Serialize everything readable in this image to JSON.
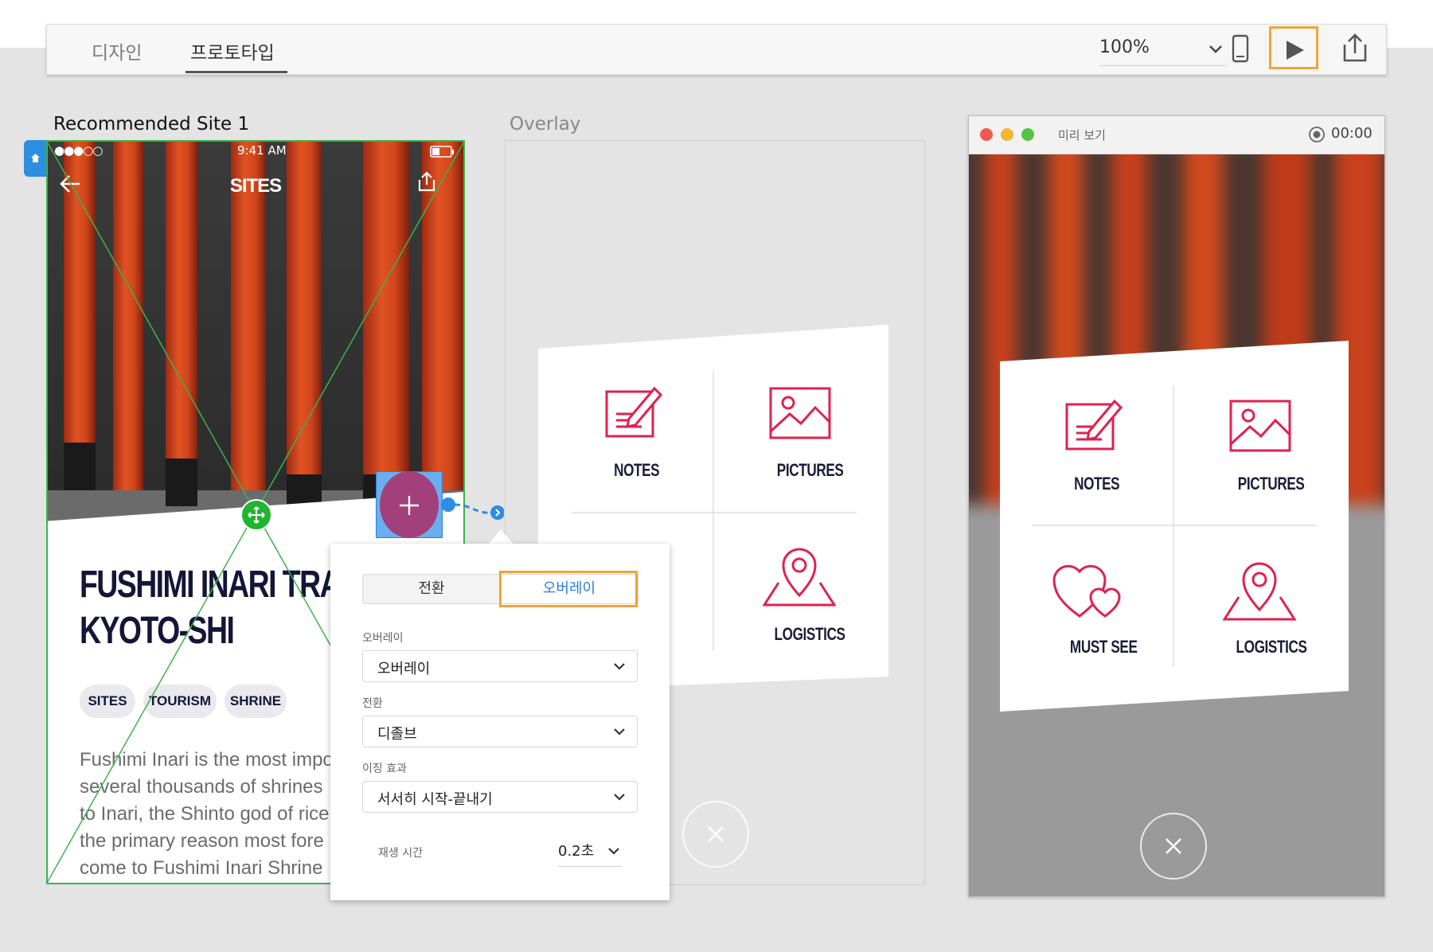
{
  "toolbar": {
    "tab_design": "디자인",
    "tab_prototype": "프로토타입",
    "zoom": "100%",
    "device_icon": "phone-icon",
    "play_icon": "play-icon",
    "share_icon": "share-icon"
  },
  "artboard1": {
    "title": "Recommended Site 1",
    "status_time": "9:41 AM",
    "status_signal": "●●●○○",
    "nav_title": "SITES",
    "heading_line1": "FUSHIMI INARI TRAI",
    "heading_line2": "KYOTO-SHI",
    "tags": [
      "SITES",
      "TOURISM",
      "SHRINE"
    ],
    "body_lines": [
      "Fushimi Inari is the most impo",
      "several thousands of shrines",
      "to Inari, the Shinto god of rice",
      "the primary reason most fore",
      "come to Fushimi Inari Shrine"
    ]
  },
  "artboard2": {
    "title": "Overlay",
    "labels": {
      "notes": "NOTES",
      "pictures": "PICTURES",
      "logistics": "LOGISTICS"
    }
  },
  "popover": {
    "seg_transition": "전환",
    "seg_overlay": "오버레이",
    "overlay_label": "오버레이",
    "overlay_value": "오버레이",
    "transition_label": "전환",
    "transition_value": "디졸브",
    "easing_label": "이징 효과",
    "easing_value": "서서히 시작-끝내기",
    "duration_label": "재생 시간",
    "duration_value": "0.2초"
  },
  "preview": {
    "title": "미리 보기",
    "timer": "00:00",
    "labels": {
      "notes": "NOTES",
      "pictures": "PICTURES",
      "must_see": "MUST SEE",
      "logistics": "LOGISTICS"
    }
  },
  "colors": {
    "accent": "#f0a436",
    "brand_red": "#e0214f",
    "selection_green": "#3cb34a",
    "link_blue": "#2b7de0",
    "plus_purple": "#a2407c"
  }
}
